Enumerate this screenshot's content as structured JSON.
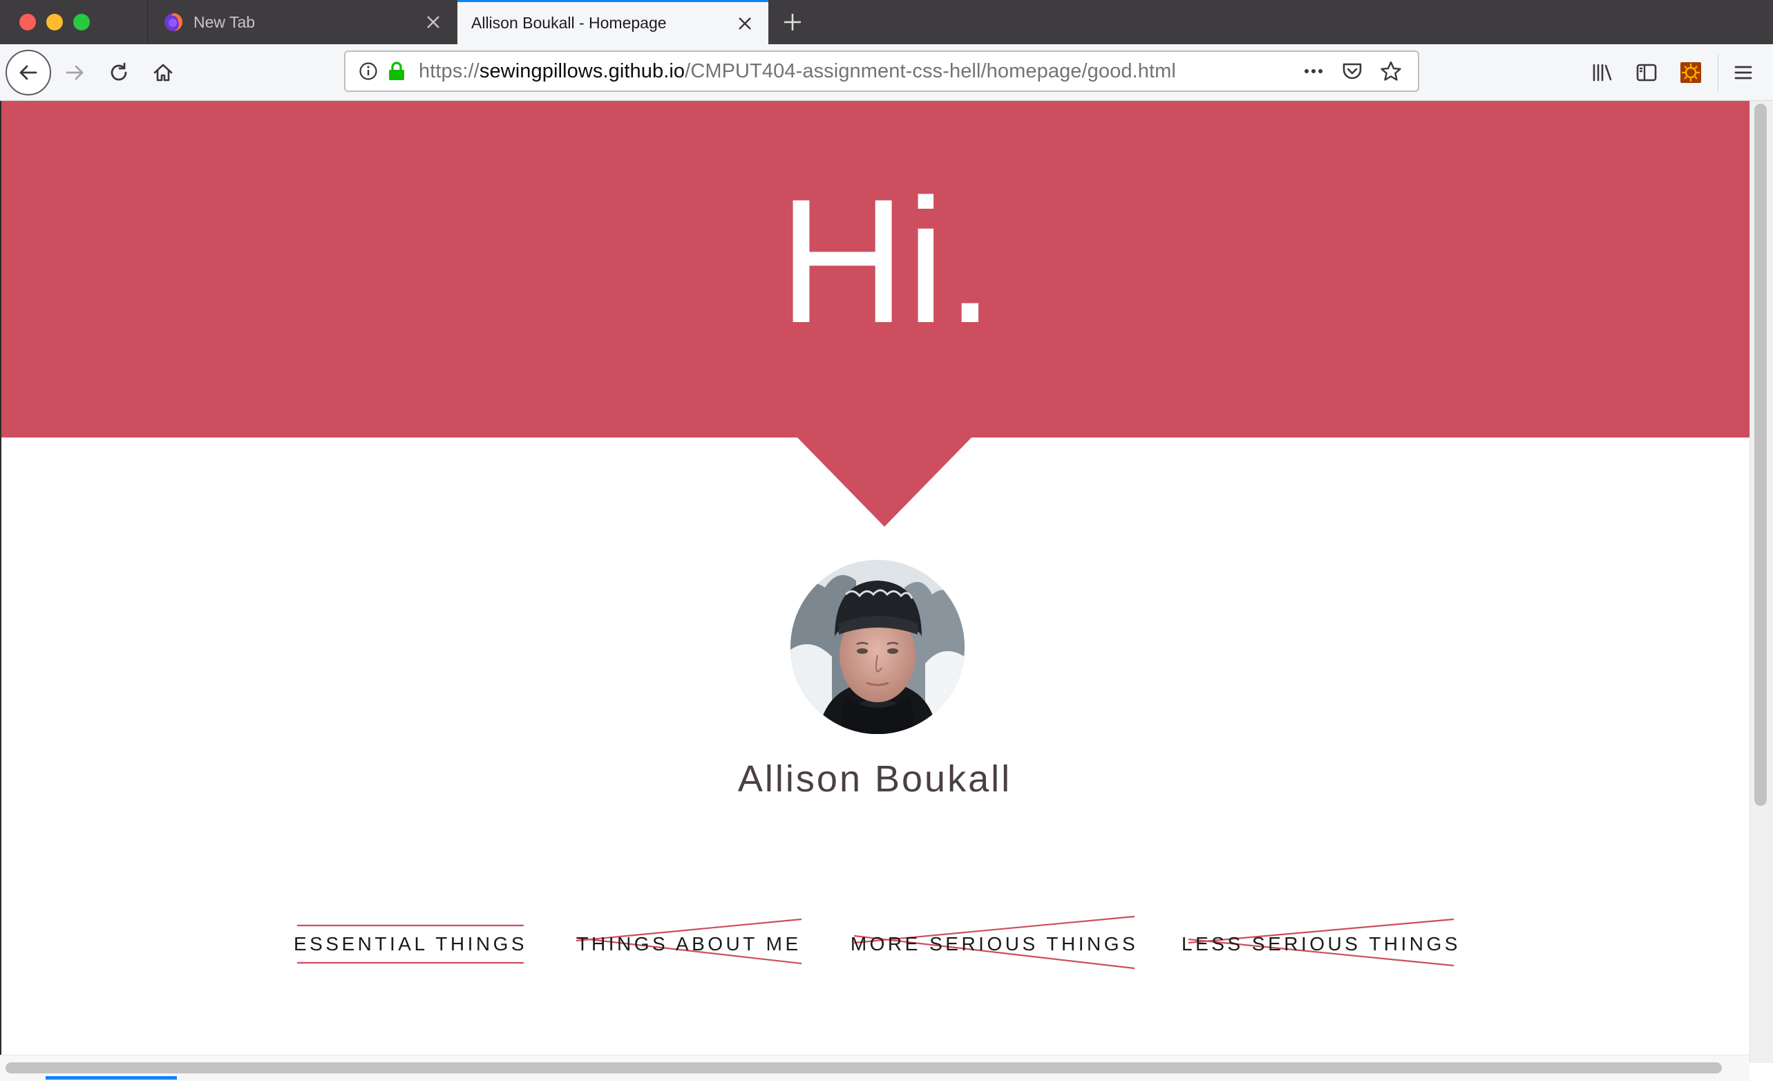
{
  "browser": {
    "tabs": [
      {
        "title": "New Tab",
        "active": false
      },
      {
        "title": "Allison Boukall - Homepage",
        "active": true
      }
    ],
    "url": {
      "scheme": "https://",
      "host": "sewingpillows.github.io",
      "path": "/CMPUT404-assignment-css-hell/homepage/good.html"
    },
    "accent_color": "#0a84ff"
  },
  "page": {
    "hero": {
      "title": "Hi.",
      "background_color": "#cc4e5f"
    },
    "profile": {
      "name": "Allison Boukall"
    },
    "nav_links": [
      {
        "label": "ESSENTIAL THINGS",
        "style": "underlined"
      },
      {
        "label": "THINGS ABOUT ME",
        "style": "crossed-out"
      },
      {
        "label": "MORE SERIOUS THINGS",
        "style": "crossed-out"
      },
      {
        "label": "LESS SERIOUS THINGS",
        "style": "crossed-out"
      }
    ]
  }
}
